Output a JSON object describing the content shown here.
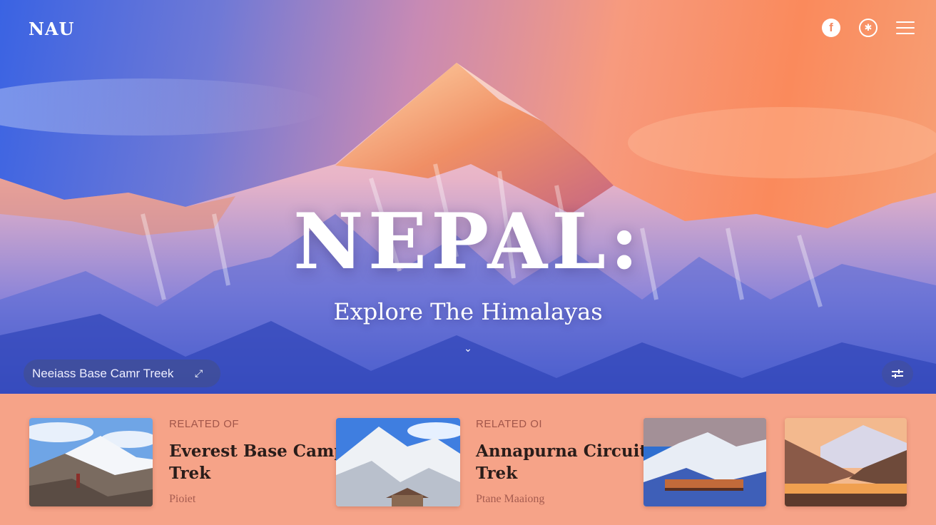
{
  "header": {
    "logo": "NAU",
    "icons": [
      {
        "name": "facebook-icon",
        "glyph": "f"
      },
      {
        "name": "star-badge-icon",
        "glyph": "✱"
      },
      {
        "name": "hamburger-menu-icon"
      }
    ]
  },
  "hero": {
    "title": "NEPAL:",
    "subtitle": "Explore The Himalayas",
    "scroll_icon": "⌄",
    "search": {
      "value": "Neeiass Base Camr Treek",
      "icon": "expand-arrow-icon"
    },
    "filter_icon": "filter-sliders-icon"
  },
  "related": [
    {
      "label": "RELATED OF",
      "title_line1": "Everest Base Camp",
      "title_line2": "Trek",
      "meta": "Pioiet"
    },
    {
      "label": "RELATED OI",
      "title_line1": "Annapurna Circuit",
      "title_line2": "Trek",
      "meta": "Ptane Maaiong"
    }
  ],
  "colors": {
    "strip_background": "#f6a388",
    "accent_text": "#a2564a",
    "title_text": "#2a1d1a"
  }
}
